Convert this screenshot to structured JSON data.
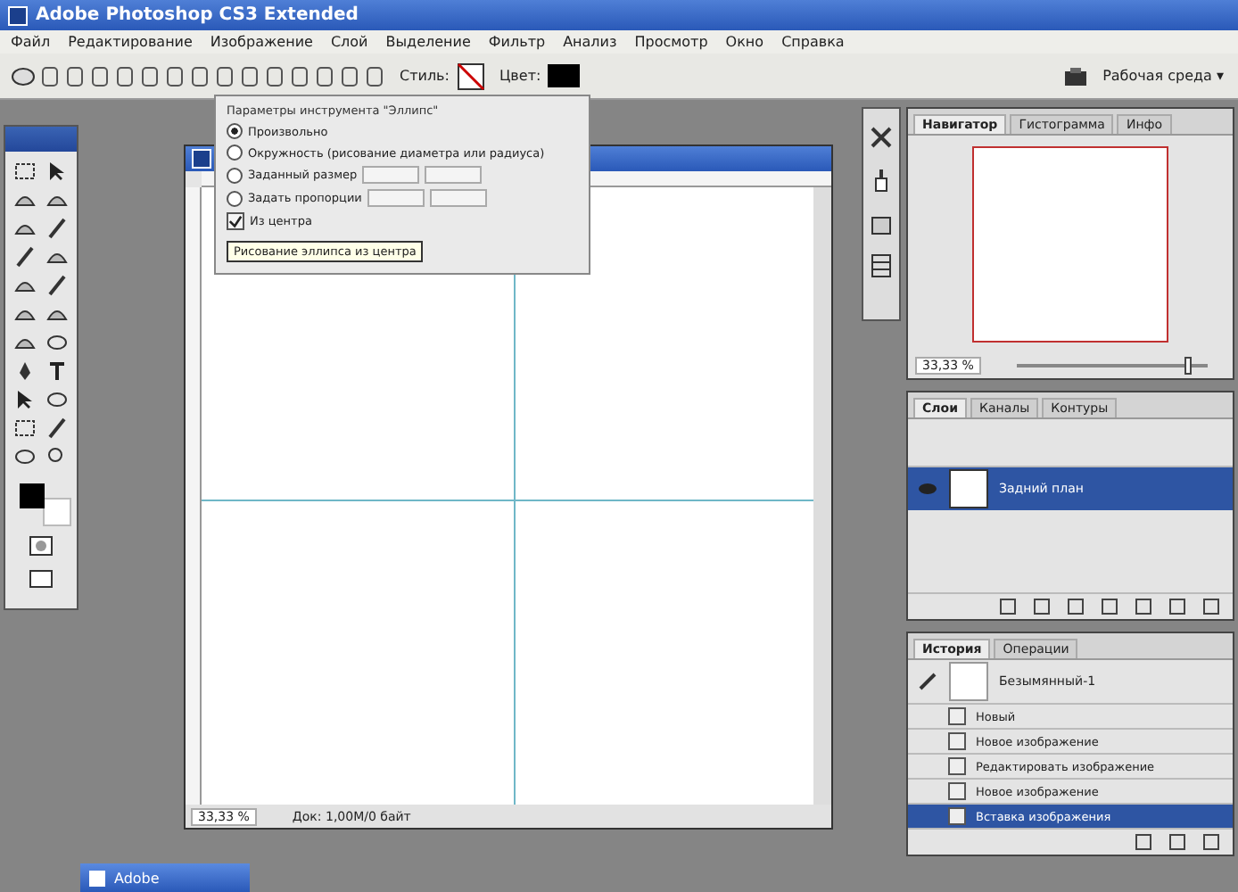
{
  "window": {
    "title": "Adobe Photoshop CS3 Extended"
  },
  "menu": [
    "Файл",
    "Редактирование",
    "Изображение",
    "Слой",
    "Выделение",
    "Фильтр",
    "Анализ",
    "Просмотр",
    "Окно",
    "Справка"
  ],
  "options_bar": {
    "style_label": "Стиль:",
    "color_label": "Цвет:",
    "workspace": "Рабочая среда ▾"
  },
  "shape_options": {
    "title": "Параметры инструмента \"Эллипс\"",
    "options": [
      {
        "label": "Произвольно",
        "selected": true
      },
      {
        "label": "Окружность (рисование диаметра или радиуса)",
        "selected": false
      },
      {
        "label": "Заданный размер",
        "selected": false
      },
      {
        "label": "Задать пропорции",
        "selected": false
      }
    ],
    "from_center": {
      "label": "Из центра",
      "checked": true
    },
    "tooltip": "Рисование эллипса из центра"
  },
  "document": {
    "zoom": "33,33 %",
    "status": "Док: 1,00M/0 байт"
  },
  "navigator": {
    "tabs": [
      {
        "label": "Навигатор",
        "selected": true
      },
      {
        "label": "Гистограмма",
        "selected": false
      },
      {
        "label": "Инфо",
        "selected": false
      }
    ],
    "zoom": "33,33 %",
    "level": 0.9
  },
  "layers": {
    "tabs": [
      {
        "label": "Слои",
        "selected": true
      },
      {
        "label": "Каналы",
        "selected": false
      },
      {
        "label": "Контуры",
        "selected": false
      }
    ],
    "items": [
      {
        "name": "Задний план",
        "selected": true
      }
    ]
  },
  "history": {
    "tabs": [
      {
        "label": "История",
        "selected": true
      },
      {
        "label": "Операции",
        "selected": false
      }
    ],
    "snapshot": "Безымянный-1",
    "steps": [
      {
        "label": "Новый",
        "selected": false
      },
      {
        "label": "Новое изображение",
        "selected": false
      },
      {
        "label": "Редактировать изображение",
        "selected": false
      },
      {
        "label": "Новое изображение",
        "selected": false
      },
      {
        "label": "Вставка изображения",
        "selected": true
      }
    ]
  },
  "taskbar": {
    "button": "Adobe"
  }
}
